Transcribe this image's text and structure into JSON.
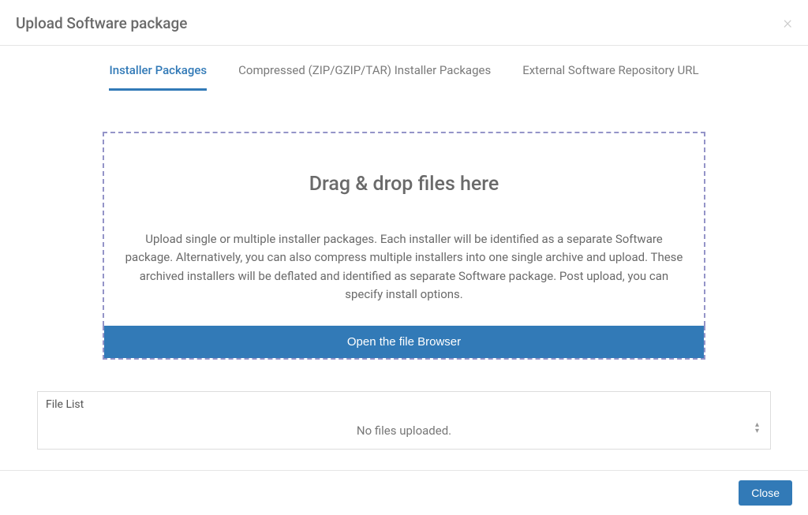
{
  "header": {
    "title": "Upload Software package"
  },
  "tabs": {
    "installer": "Installer Packages",
    "compressed": "Compressed (ZIP/GZIP/TAR) Installer Packages",
    "external": "External Software Repository URL"
  },
  "dropzone": {
    "title": "Drag & drop files here",
    "description": "Upload single or multiple installer packages. Each installer will be identified as a separate Software package. Alternatively, you can also compress multiple installers into one single archive and upload. These archived installers will be deflated and identified as separate Software package. Post upload, you can specify install options.",
    "browse_button": "Open the file Browser"
  },
  "file_list": {
    "label": "File List",
    "empty_message": "No files uploaded."
  },
  "footer": {
    "close": "Close"
  }
}
